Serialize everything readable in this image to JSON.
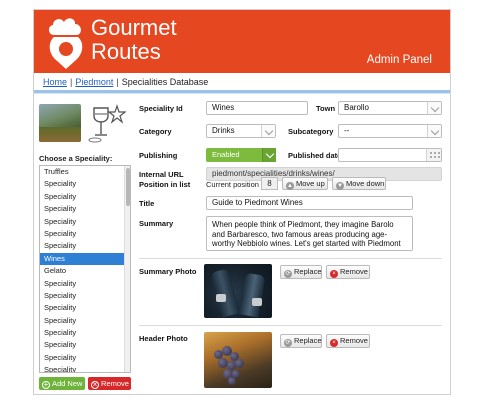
{
  "brand": {
    "line1": "Gourmet",
    "line2": "Routes",
    "accent_color": "#e54721"
  },
  "header": {
    "admin_title": "Admin Panel"
  },
  "breadcrumb": {
    "home": "Home",
    "region": "Piedmont",
    "current": "Specialities Database",
    "separator": "|"
  },
  "sidebar": {
    "choose_label": "Choose a Speciality:",
    "items": [
      {
        "label": "Truffles",
        "selected": false
      },
      {
        "label": "Speciality",
        "selected": false
      },
      {
        "label": "Speciality",
        "selected": false
      },
      {
        "label": "Speciality",
        "selected": false
      },
      {
        "label": "Speciality",
        "selected": false
      },
      {
        "label": "Speciality",
        "selected": false
      },
      {
        "label": "Speciality",
        "selected": false
      },
      {
        "label": "Wines",
        "selected": true
      },
      {
        "label": "Gelato",
        "selected": false
      },
      {
        "label": "Speciality",
        "selected": false
      },
      {
        "label": "Speciality",
        "selected": false
      },
      {
        "label": "Speciality",
        "selected": false
      },
      {
        "label": "Speciality",
        "selected": false
      },
      {
        "label": "Speciality",
        "selected": false
      },
      {
        "label": "Speciality",
        "selected": false
      },
      {
        "label": "Speciality",
        "selected": false
      },
      {
        "label": "Speciality",
        "selected": false
      }
    ],
    "add_label": "Add New",
    "remove_label": "Remove"
  },
  "form": {
    "speciality_id": {
      "label": "Speciality Id",
      "value": "Wines"
    },
    "town": {
      "label": "Town",
      "value": "Barollo"
    },
    "category": {
      "label": "Category",
      "value": "Drinks"
    },
    "subcategory": {
      "label": "Subcategory",
      "value": "--"
    },
    "publishing": {
      "label": "Publishing",
      "value": "Enabled",
      "color": "#7dbb3f"
    },
    "published_date": {
      "label": "Published date:",
      "value": ""
    },
    "internal_url": {
      "label": "Internal URL",
      "value": "piedmont/specialities/drinks/wines/"
    },
    "position": {
      "label": "Position in list",
      "current_label": "Current position",
      "value": "8",
      "move_up": "Move up",
      "move_down": "Move down"
    },
    "title": {
      "label": "Title",
      "value": "Guide to Piedmont Wines"
    },
    "summary": {
      "label": "Summary",
      "value": "When people think of Piedmont, they imagine Barolo and Barbaresco, two famous areas producing age-worthy Nebbiolo wines. Let's get started with Piedmont wine."
    },
    "summary_photo": {
      "label": "Summary Photo",
      "replace": "Replace",
      "remove": "Remove"
    },
    "header_photo": {
      "label": "Header Photo",
      "replace": "Replace",
      "remove": "Remove"
    }
  }
}
